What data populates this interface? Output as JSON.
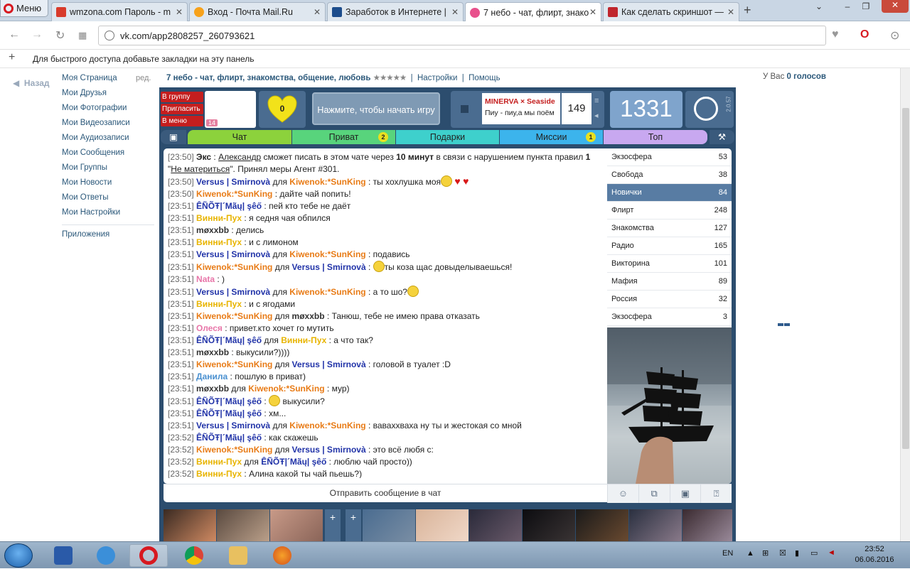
{
  "browser": {
    "menu_label": "Меню",
    "tabs": [
      {
        "title": "wmzona.com Пароль - m",
        "fav": "#d83b2b"
      },
      {
        "title": "Вход - Почта Mail.Ru",
        "fav": "#f7a21b"
      },
      {
        "title": "Заработок в Интернете |",
        "fav": "#1d4d8c"
      },
      {
        "title": "7 небо - чат, флирт, знако",
        "fav": "#e8508c"
      },
      {
        "title": "Как сделать скриншот —",
        "fav": "#c0262d"
      }
    ],
    "url": "vk.com/app2808257_260793621",
    "bookmarks_hint": "Для быстрого доступа добавьте закладки на эту панель"
  },
  "vk": {
    "back_label": "Назад",
    "edit_label": "ред.",
    "menu": [
      "Моя Страница",
      "Мои Друзья",
      "Мои Фотографии",
      "Мои Видеозаписи",
      "Мои Аудиозаписи",
      "Мои Сообщения",
      "Мои Группы",
      "Мои Новости",
      "Мои Ответы",
      "Мои Настройки"
    ],
    "apps_label": "Приложения",
    "app_title": "7 небо - чат, флирт, знакомства, общение, любовь",
    "app_stars": "★★★★★",
    "settings_link": "Настройки",
    "help_link": "Помощь",
    "votes_prefix": "У Вас ",
    "votes_value": "0 голосов"
  },
  "game": {
    "side_buttons": [
      "В группу",
      "Пригласить",
      "В меню"
    ],
    "avatar_badge": "14",
    "heart_value": "0",
    "start_label": "Нажмите, чтобы начать игру",
    "track_artist": "MINERVA × Seaside",
    "track_title": "Пиу - пиу,а мы поём",
    "track_count": "149",
    "counter": "1331",
    "version": "2.0.57",
    "tabs": [
      {
        "label": "Чат",
        "color": "#8cd23c",
        "badge": ""
      },
      {
        "label": "Приват",
        "color": "#58d47c",
        "badge": "2"
      },
      {
        "label": "Подарки",
        "color": "#3ed0cc",
        "badge": ""
      },
      {
        "label": "Миссии",
        "color": "#3cb4ec",
        "badge": "1"
      },
      {
        "label": "Топ",
        "color": "#c8a8f0",
        "badge": ""
      }
    ],
    "rooms": [
      {
        "name": "Экзосфера",
        "count": "53"
      },
      {
        "name": "Свобода",
        "count": "38"
      },
      {
        "name": "Новички",
        "count": "84"
      },
      {
        "name": "Флирт",
        "count": "248"
      },
      {
        "name": "Знакомства",
        "count": "127"
      },
      {
        "name": "Радио",
        "count": "165"
      },
      {
        "name": "Викторина",
        "count": "101"
      },
      {
        "name": "Мафия",
        "count": "89"
      },
      {
        "name": "Россия",
        "count": "32"
      },
      {
        "name": "Экзосфера",
        "count": "3"
      }
    ],
    "active_room_index": 2,
    "send_placeholder": "Отправить сообщение в чат",
    "messages": [
      {
        "ts": "[23:50]",
        "parts": [
          [
            "Экс",
            "c-exc",
            "b"
          ],
          [
            " : ",
            ""
          ],
          [
            "Александр",
            "u",
            ""
          ],
          [
            " сможет писать в этом чате через ",
            ""
          ],
          [
            "10 минут",
            "",
            "b"
          ],
          [
            " в связи с нарушением пункта правил ",
            ""
          ],
          [
            "1",
            "",
            "b"
          ],
          [
            " \"",
            ""
          ],
          [
            "Не материться",
            "u",
            ""
          ],
          [
            "\". Принял меры Агент #301.",
            ""
          ]
        ]
      },
      {
        "ts": "[23:50]",
        "parts": [
          [
            "Versus | Smirnovà",
            "c-blue",
            "b"
          ],
          [
            " для ",
            ""
          ],
          [
            "Kiwenok:*SunKing",
            "c-orange",
            "b"
          ],
          [
            " : ты хохлушка моя",
            ""
          ],
          [
            "@emoji",
            ""
          ],
          [
            " ",
            ""
          ],
          [
            "♥",
            "hrt"
          ],
          [
            " ",
            ""
          ],
          [
            "♥",
            "hrt"
          ]
        ]
      },
      {
        "ts": "[23:50]",
        "parts": [
          [
            "Kiwenok:*SunKing",
            "c-orange",
            "b"
          ],
          [
            " : дайте чай попить!",
            ""
          ]
        ]
      },
      {
        "ts": "[23:51]",
        "parts": [
          [
            "ÊÑÕŦ|´Mãų| şêő",
            "c-blue",
            "b"
          ],
          [
            " : пей кто тебе не даёт",
            ""
          ]
        ]
      },
      {
        "ts": "[23:51]",
        "parts": [
          [
            "Винни-Пух",
            "c-yellow",
            "b"
          ],
          [
            " : я седня чая обпился",
            ""
          ]
        ]
      },
      {
        "ts": "[23:51]",
        "parts": [
          [
            "møxxbb",
            "c-dark",
            "b"
          ],
          [
            " : делись",
            ""
          ]
        ]
      },
      {
        "ts": "[23:51]",
        "parts": [
          [
            "Винни-Пух",
            "c-yellow",
            "b"
          ],
          [
            " : и с лимоном",
            ""
          ]
        ]
      },
      {
        "ts": "[23:51]",
        "parts": [
          [
            "Versus | Smirnovà",
            "c-blue",
            "b"
          ],
          [
            " для ",
            ""
          ],
          [
            "Kiwenok:*SunKing",
            "c-orange",
            "b"
          ],
          [
            " : подавись",
            ""
          ]
        ]
      },
      {
        "ts": "[23:51]",
        "parts": [
          [
            "Kiwenok:*SunKing",
            "c-orange",
            "b"
          ],
          [
            " для ",
            ""
          ],
          [
            "Versus | Smirnovà",
            "c-blue",
            "b"
          ],
          [
            " : ",
            ""
          ],
          [
            "@emoji",
            ""
          ],
          [
            "ты коза щас довыделываешься!",
            ""
          ]
        ]
      },
      {
        "ts": "[23:51]",
        "parts": [
          [
            "Nata",
            "c-pink",
            "b"
          ],
          [
            " : )",
            ""
          ]
        ]
      },
      {
        "ts": "[23:51]",
        "parts": [
          [
            "Versus | Smirnovà",
            "c-blue",
            "b"
          ],
          [
            " для ",
            ""
          ],
          [
            "Kiwenok:*SunKing",
            "c-orange",
            "b"
          ],
          [
            " : а то шо?",
            ""
          ],
          [
            "@emoji",
            ""
          ]
        ]
      },
      {
        "ts": "[23:51]",
        "parts": [
          [
            "Винни-Пух",
            "c-yellow",
            "b"
          ],
          [
            " : и с ягодами",
            ""
          ]
        ]
      },
      {
        "ts": "[23:51]",
        "parts": [
          [
            "Kiwenok:*SunKing",
            "c-orange",
            "b"
          ],
          [
            " для ",
            ""
          ],
          [
            "møxxbb",
            "c-dark",
            "b"
          ],
          [
            " : Танюш, тебе не имею права отказать",
            ""
          ]
        ]
      },
      {
        "ts": "[23:51]",
        "parts": [
          [
            "Олеся",
            "c-pink",
            "b"
          ],
          [
            " : привет.кто хочет го мутить",
            ""
          ]
        ]
      },
      {
        "ts": "[23:51]",
        "parts": [
          [
            "ÊÑÕŦ|´Mãų| şêő",
            "c-blue",
            "b"
          ],
          [
            " для ",
            ""
          ],
          [
            "Винни-Пух",
            "c-yellow",
            "b"
          ],
          [
            " : а что так?",
            ""
          ]
        ]
      },
      {
        "ts": "[23:51]",
        "parts": [
          [
            "møxxbb",
            "c-dark",
            "b"
          ],
          [
            " : выкусили?))))",
            ""
          ]
        ]
      },
      {
        "ts": "[23:51]",
        "parts": [
          [
            "Kiwenok:*SunKing",
            "c-orange",
            "b"
          ],
          [
            " для ",
            ""
          ],
          [
            "Versus | Smirnovà",
            "c-blue",
            "b"
          ],
          [
            " : головой в туалет :D",
            ""
          ]
        ]
      },
      {
        "ts": "[23:51]",
        "parts": [
          [
            "Данила",
            "c-lblue",
            "b"
          ],
          [
            " : пошлую в приват)",
            ""
          ]
        ]
      },
      {
        "ts": "[23:51]",
        "parts": [
          [
            "møxxbb",
            "c-dark",
            "b"
          ],
          [
            " для ",
            ""
          ],
          [
            "Kiwenok:*SunKing",
            "c-orange",
            "b"
          ],
          [
            " : мур)",
            ""
          ]
        ]
      },
      {
        "ts": "[23:51]",
        "parts": [
          [
            "ÊÑÕŦ|´Mãų| şêő",
            "c-blue",
            "b"
          ],
          [
            " : ",
            ""
          ],
          [
            "@emoji",
            ""
          ],
          [
            " выкусили?",
            ""
          ]
        ]
      },
      {
        "ts": "[23:51]",
        "parts": [
          [
            "ÊÑÕŦ|´Mãų| şêő",
            "c-blue",
            "b"
          ],
          [
            " : хм...",
            ""
          ]
        ]
      },
      {
        "ts": "[23:51]",
        "parts": [
          [
            "Versus | Smirnovà",
            "c-blue",
            "b"
          ],
          [
            " для ",
            ""
          ],
          [
            "Kiwenok:*SunKing",
            "c-orange",
            "b"
          ],
          [
            " : ваваххваха ну ты и жестокая со мной",
            ""
          ]
        ]
      },
      {
        "ts": "[23:52]",
        "parts": [
          [
            "ÊÑÕŦ|´Mãų| şêő",
            "c-blue",
            "b"
          ],
          [
            " : как скажешь",
            ""
          ]
        ]
      },
      {
        "ts": "[23:52]",
        "parts": [
          [
            "Kiwenok:*SunKing",
            "c-orange",
            "b"
          ],
          [
            " для ",
            ""
          ],
          [
            "Versus | Smirnovà",
            "c-blue",
            "b"
          ],
          [
            " : это всё любя с:",
            ""
          ]
        ]
      },
      {
        "ts": "[23:52]",
        "parts": [
          [
            "Винни-Пух",
            "c-yellow",
            "b"
          ],
          [
            " для ",
            ""
          ],
          [
            "ÊÑÕŦ|´Mãų| şêő",
            "c-blue",
            "b"
          ],
          [
            " : люблю чай просто))",
            ""
          ]
        ]
      },
      {
        "ts": "[23:52]",
        "parts": [
          [
            "Винни-Пух",
            "c-yellow",
            "b"
          ],
          [
            " : Алина какой ты чай пьешь?)",
            ""
          ]
        ]
      }
    ]
  },
  "taskbar": {
    "lang": "EN",
    "time": "23:52",
    "date": "06.06.2016"
  }
}
